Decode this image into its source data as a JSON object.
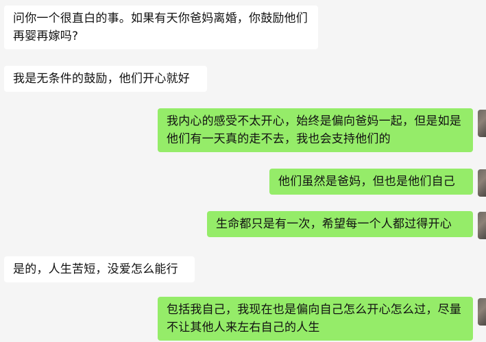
{
  "messages": [
    {
      "side": "left",
      "text": "问你一个很直白的事。如果有天你爸妈离婚，你鼓励他们再婴再嫁吗?"
    },
    {
      "side": "left",
      "text": "我是无条件的鼓励，他们开心就好"
    },
    {
      "side": "right",
      "text": "我内心的感受不太开心，始终是偏向爸妈一起，但是如是他们有一天真的走不去，我也会支持他们的"
    },
    {
      "side": "right",
      "text": "他们虽然是爸妈，但也是他们自己"
    },
    {
      "side": "right",
      "text": "生命都只是有一次，希望每一个人都过得开心"
    },
    {
      "side": "left",
      "text": "是的，人生苦短，没爱怎么能行"
    },
    {
      "side": "right",
      "text": "包括我自己，我现在也是偏向自己怎么开心怎么过，尽量不让其他人来左右自己的人生"
    }
  ]
}
